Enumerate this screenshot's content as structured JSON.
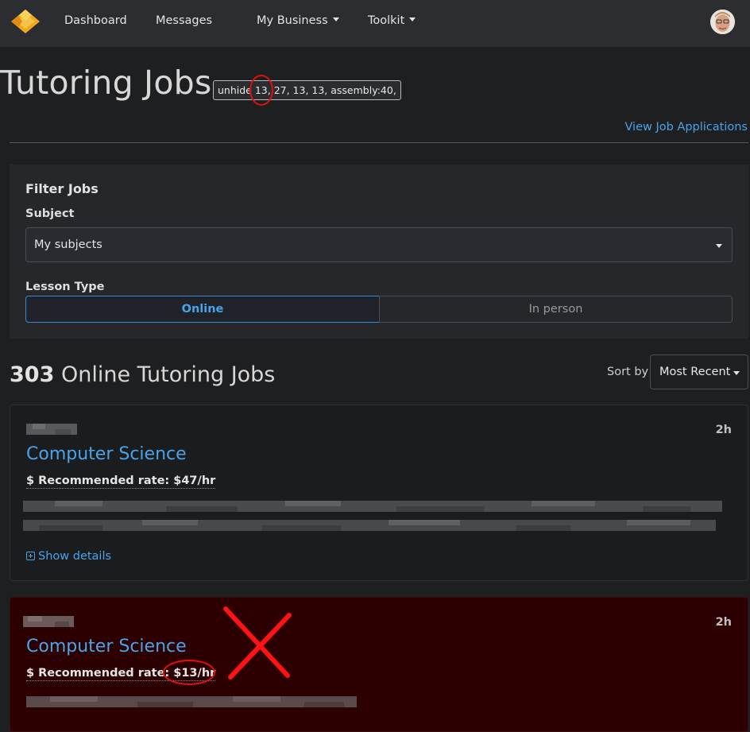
{
  "nav": {
    "items": [
      {
        "label": "Dashboard"
      },
      {
        "label": "Messages"
      },
      {
        "label": "My Business"
      },
      {
        "label": "Toolkit"
      }
    ]
  },
  "header": {
    "title": "Tutoring Jobs",
    "tooltip": "unhide 13, 27, 13, 13, assembly:40,",
    "view_applications": "View Job Applications"
  },
  "filter": {
    "title": "Filter Jobs",
    "subject_label": "Subject",
    "subject_value": "My subjects",
    "lesson_type_label": "Lesson Type",
    "lesson_types": [
      "Online",
      "In person"
    ],
    "selected_lesson_type": "Online"
  },
  "results": {
    "count": "303",
    "label": "Online Tutoring Jobs",
    "sort_label": "Sort by",
    "sort_value": "Most Recent"
  },
  "jobs": [
    {
      "time": "2h",
      "subject": "Computer Science",
      "rate": "$ Recommended rate: $47/hr",
      "show_details": "Show details"
    },
    {
      "time": "2h",
      "subject": "Computer Science",
      "rate": "$ Recommended rate: $13/hr"
    }
  ],
  "colors": {
    "accent": "#4aa3e8",
    "background": "#1e1f21",
    "navbar": "#2b2d30",
    "highlight_bad_job": "#2c0000",
    "annotation": "#e01010"
  }
}
